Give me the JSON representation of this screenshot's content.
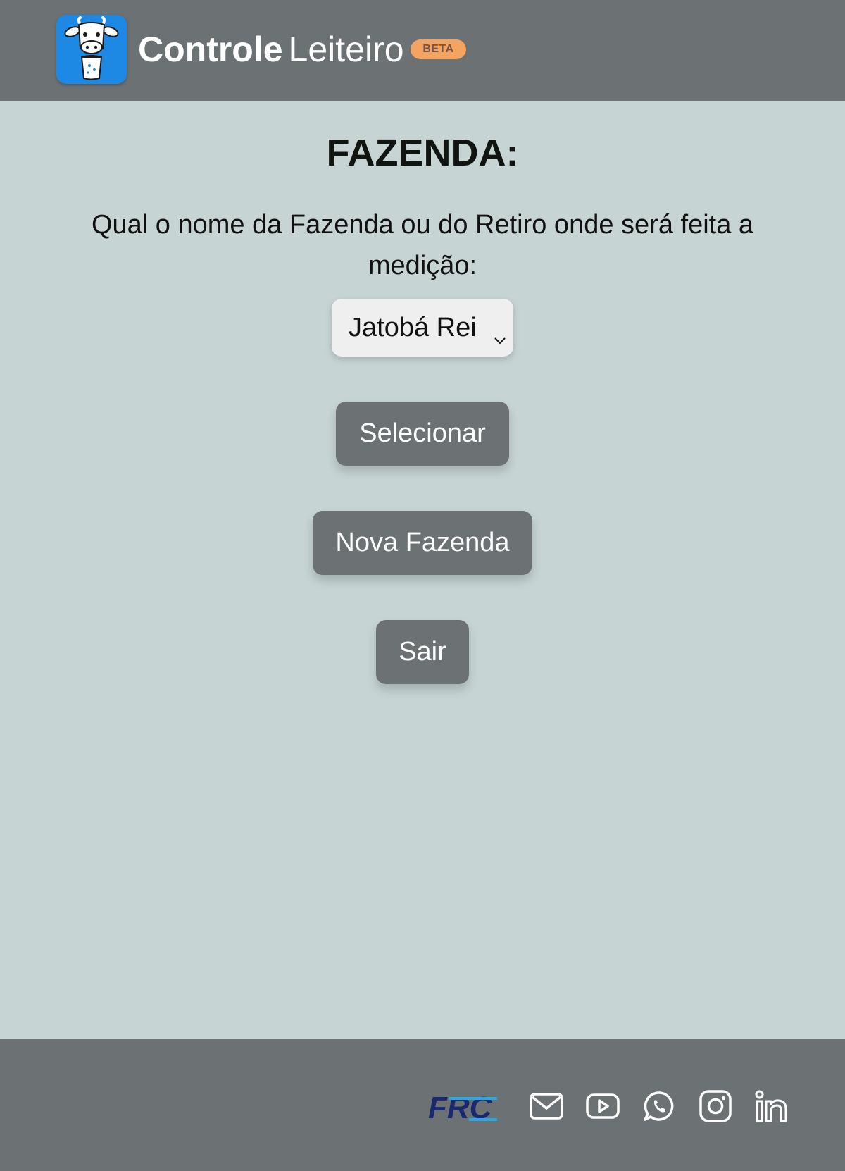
{
  "header": {
    "brand_bold": "Controle",
    "brand_light": "Leiteiro",
    "badge": "BETA"
  },
  "main": {
    "title": "FAZENDA:",
    "question": "Qual o nome da Fazenda ou do Retiro onde será feita a medição:",
    "farm_select": {
      "selected": "Jatobá Rei"
    },
    "buttons": {
      "select": "Selecionar",
      "new_farm": "Nova Fazenda",
      "exit": "Sair"
    }
  },
  "footer": {
    "logo_text": "FRC",
    "icons": [
      "email-icon",
      "youtube-icon",
      "whatsapp-icon",
      "instagram-icon",
      "linkedin-icon"
    ]
  },
  "colors": {
    "header_bg": "#6c7174",
    "page_bg": "#c6d5d4",
    "logo_bg": "#1e88e5",
    "badge_bg": "#f4a460",
    "button_bg": "#6c7174"
  }
}
